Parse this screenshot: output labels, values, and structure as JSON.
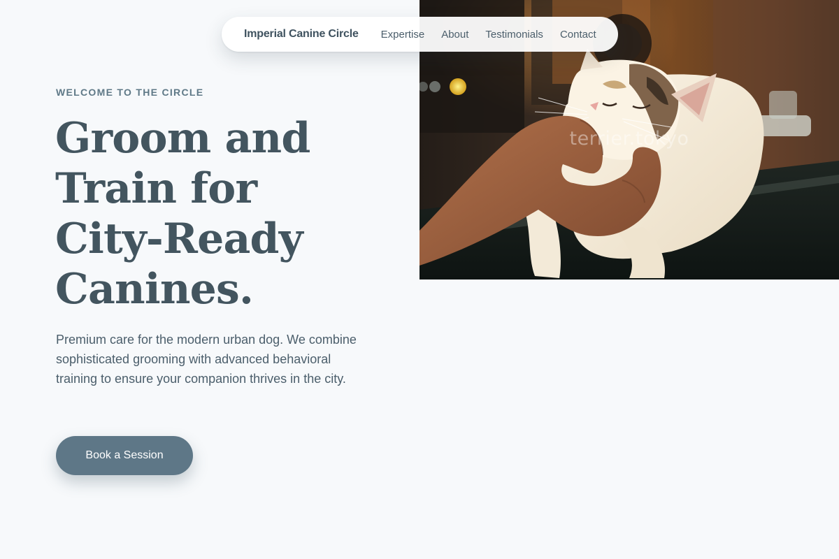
{
  "nav": {
    "brand": "Imperial Canine Circle",
    "links": [
      "Expertise",
      "About",
      "Testimonials",
      "Contact"
    ]
  },
  "hero": {
    "eyebrow": "WELCOME TO THE CIRCLE",
    "headline_lines": [
      "Groom and",
      "Train for",
      "City-Ready",
      "Canines."
    ],
    "lede": "Premium care for the modern urban dog. We combine sophisticated grooming with advanced behavioral training to ensure your companion thrives in the city.",
    "cta_label": "Book a Session"
  },
  "photo": {
    "watermark": "terrier.tokyo",
    "subject": "hand petting a calico cat"
  },
  "colors": {
    "background": "#f7f9fb",
    "heading": "#43555f",
    "accent_button": "#5e7787",
    "eyebrow": "#5f7987"
  }
}
